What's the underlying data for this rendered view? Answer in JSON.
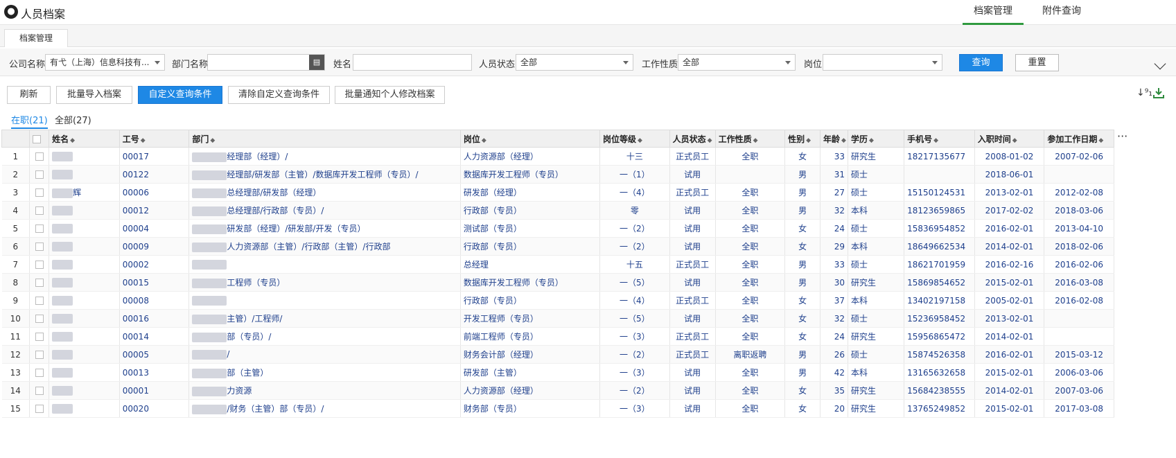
{
  "app": {
    "title": "人员档案",
    "nav": [
      "档案管理",
      "附件查询"
    ],
    "active_nav": 0
  },
  "tab": {
    "label": "档案管理"
  },
  "filters": {
    "company": {
      "label": "公司名称",
      "value": "有弋（上海）信息科技有..."
    },
    "dept": {
      "label": "部门名称",
      "value": ""
    },
    "name": {
      "label": "姓名",
      "value": ""
    },
    "status": {
      "label": "人员状态",
      "value": "全部"
    },
    "nature": {
      "label": "工作性质",
      "value": "全部"
    },
    "post": {
      "label": "岗位",
      "value": ""
    },
    "query_btn": "查询",
    "reset_btn": "重置"
  },
  "actions": [
    "刷新",
    "批量导入档案",
    "自定义查询条件",
    "清除自定义查询条件",
    "批量通知个人修改档案"
  ],
  "status_tabs": [
    "在职(21)",
    "全部(27)"
  ],
  "columns": [
    "姓名",
    "工号",
    "部门",
    "岗位",
    "岗位等级",
    "人员状态",
    "工作性质",
    "性别",
    "年龄",
    "学历",
    "手机号",
    "入职时间",
    "参加工作日期"
  ],
  "more_label": "···",
  "rows": [
    {
      "n": "1",
      "name": "",
      "id": "00017",
      "dept": "经理部（经理）/",
      "post": "人力资源部（经理）",
      "level": "十三",
      "status": "正式员工",
      "nature": "全职",
      "sex": "女",
      "age": "33",
      "edu": "研究生",
      "phone": "18217135677",
      "join": "2008-01-02",
      "work": "2007-02-06"
    },
    {
      "n": "2",
      "name": "",
      "id": "00122",
      "dept": "经理部/研发部（主管）/数据库开发工程师（专员）/",
      "post": "数据库开发工程师（专员）",
      "level": "一（1）",
      "status": "试用",
      "nature": "",
      "sex": "男",
      "age": "31",
      "edu": "硕士",
      "phone": "",
      "join": "2018-06-01",
      "work": ""
    },
    {
      "n": "3",
      "name": "辉",
      "id": "00006",
      "dept": "总经理部/研发部（经理）",
      "post": "研发部（经理）",
      "level": "一（4）",
      "status": "正式员工",
      "nature": "全职",
      "sex": "男",
      "age": "27",
      "edu": "硕士",
      "phone": "15150124531",
      "join": "2013-02-01",
      "work": "2012-02-08"
    },
    {
      "n": "4",
      "name": "",
      "id": "00012",
      "dept": "总经理部/行政部（专员）/",
      "post": "行政部（专员）",
      "level": "零",
      "status": "试用",
      "nature": "全职",
      "sex": "男",
      "age": "32",
      "edu": "本科",
      "phone": "18123659865",
      "join": "2017-02-02",
      "work": "2018-03-06"
    },
    {
      "n": "5",
      "name": "",
      "id": "00004",
      "dept": "研发部（经理）/研发部/开发（专员）",
      "post": "测试部（专员）",
      "level": "一（2）",
      "status": "试用",
      "nature": "全职",
      "sex": "女",
      "age": "24",
      "edu": "硕士",
      "phone": "15836954852",
      "join": "2016-02-01",
      "work": "2013-04-10"
    },
    {
      "n": "6",
      "name": "",
      "id": "00009",
      "dept": "人力资源部（主管）/行政部（主管）/行政部",
      "post": "行政部（专员）",
      "level": "一（2）",
      "status": "试用",
      "nature": "全职",
      "sex": "女",
      "age": "29",
      "edu": "本科",
      "phone": "18649662534",
      "join": "2014-02-01",
      "work": "2018-02-06"
    },
    {
      "n": "7",
      "name": "",
      "id": "00002",
      "dept": "",
      "post": "总经理",
      "level": "十五",
      "status": "正式员工",
      "nature": "全职",
      "sex": "男",
      "age": "33",
      "edu": "硕士",
      "phone": "18621701959",
      "join": "2016-02-16",
      "work": "2016-02-06"
    },
    {
      "n": "8",
      "name": "",
      "id": "00015",
      "dept": "工程师（专员）",
      "post": "数据库开发工程师（专员）",
      "level": "一（5）",
      "status": "试用",
      "nature": "全职",
      "sex": "男",
      "age": "30",
      "edu": "研究生",
      "phone": "15869854652",
      "join": "2015-02-01",
      "work": "2016-03-08"
    },
    {
      "n": "9",
      "name": "",
      "id": "00008",
      "dept": "",
      "post": "行政部（专员）",
      "level": "一（4）",
      "status": "正式员工",
      "nature": "全职",
      "sex": "女",
      "age": "37",
      "edu": "本科",
      "phone": "13402197158",
      "join": "2005-02-01",
      "work": "2016-02-08"
    },
    {
      "n": "10",
      "name": "",
      "id": "00016",
      "dept": "主管）/工程师/",
      "post": "开发工程师（专员）",
      "level": "一（5）",
      "status": "试用",
      "nature": "全职",
      "sex": "女",
      "age": "32",
      "edu": "硕士",
      "phone": "15236958452",
      "join": "2013-02-01",
      "work": ""
    },
    {
      "n": "11",
      "name": "",
      "id": "00014",
      "dept": "部（专员）/",
      "post": "前端工程师（专员）",
      "level": "一（3）",
      "status": "正式员工",
      "nature": "全职",
      "sex": "女",
      "age": "24",
      "edu": "研究生",
      "phone": "15956865472",
      "join": "2014-02-01",
      "work": ""
    },
    {
      "n": "12",
      "name": "",
      "id": "00005",
      "dept": "/",
      "post": "财务会计部（经理）",
      "level": "一（2）",
      "status": "正式员工",
      "nature": "离职返聘",
      "sex": "男",
      "age": "26",
      "edu": "硕士",
      "phone": "15874526358",
      "join": "2016-02-01",
      "work": "2015-03-12"
    },
    {
      "n": "13",
      "name": "",
      "id": "00013",
      "dept": "部（主管）",
      "post": "研发部（主管）",
      "level": "一（3）",
      "status": "试用",
      "nature": "全职",
      "sex": "男",
      "age": "42",
      "edu": "本科",
      "phone": "13165632658",
      "join": "2015-02-01",
      "work": "2006-03-06"
    },
    {
      "n": "14",
      "name": "",
      "id": "00001",
      "dept": "力资源",
      "post": "人力资源部（经理）",
      "level": "一（2）",
      "status": "试用",
      "nature": "全职",
      "sex": "女",
      "age": "35",
      "edu": "研究生",
      "phone": "15684238555",
      "join": "2014-02-01",
      "work": "2007-03-06"
    },
    {
      "n": "15",
      "name": "",
      "id": "00020",
      "dept": "/财务（主管）部（专员）/",
      "post": "财务部（专员）",
      "level": "一（3）",
      "status": "试用",
      "nature": "全职",
      "sex": "女",
      "age": "20",
      "edu": "研究生",
      "phone": "13765249852",
      "join": "2015-02-01",
      "work": "2017-03-08"
    }
  ]
}
